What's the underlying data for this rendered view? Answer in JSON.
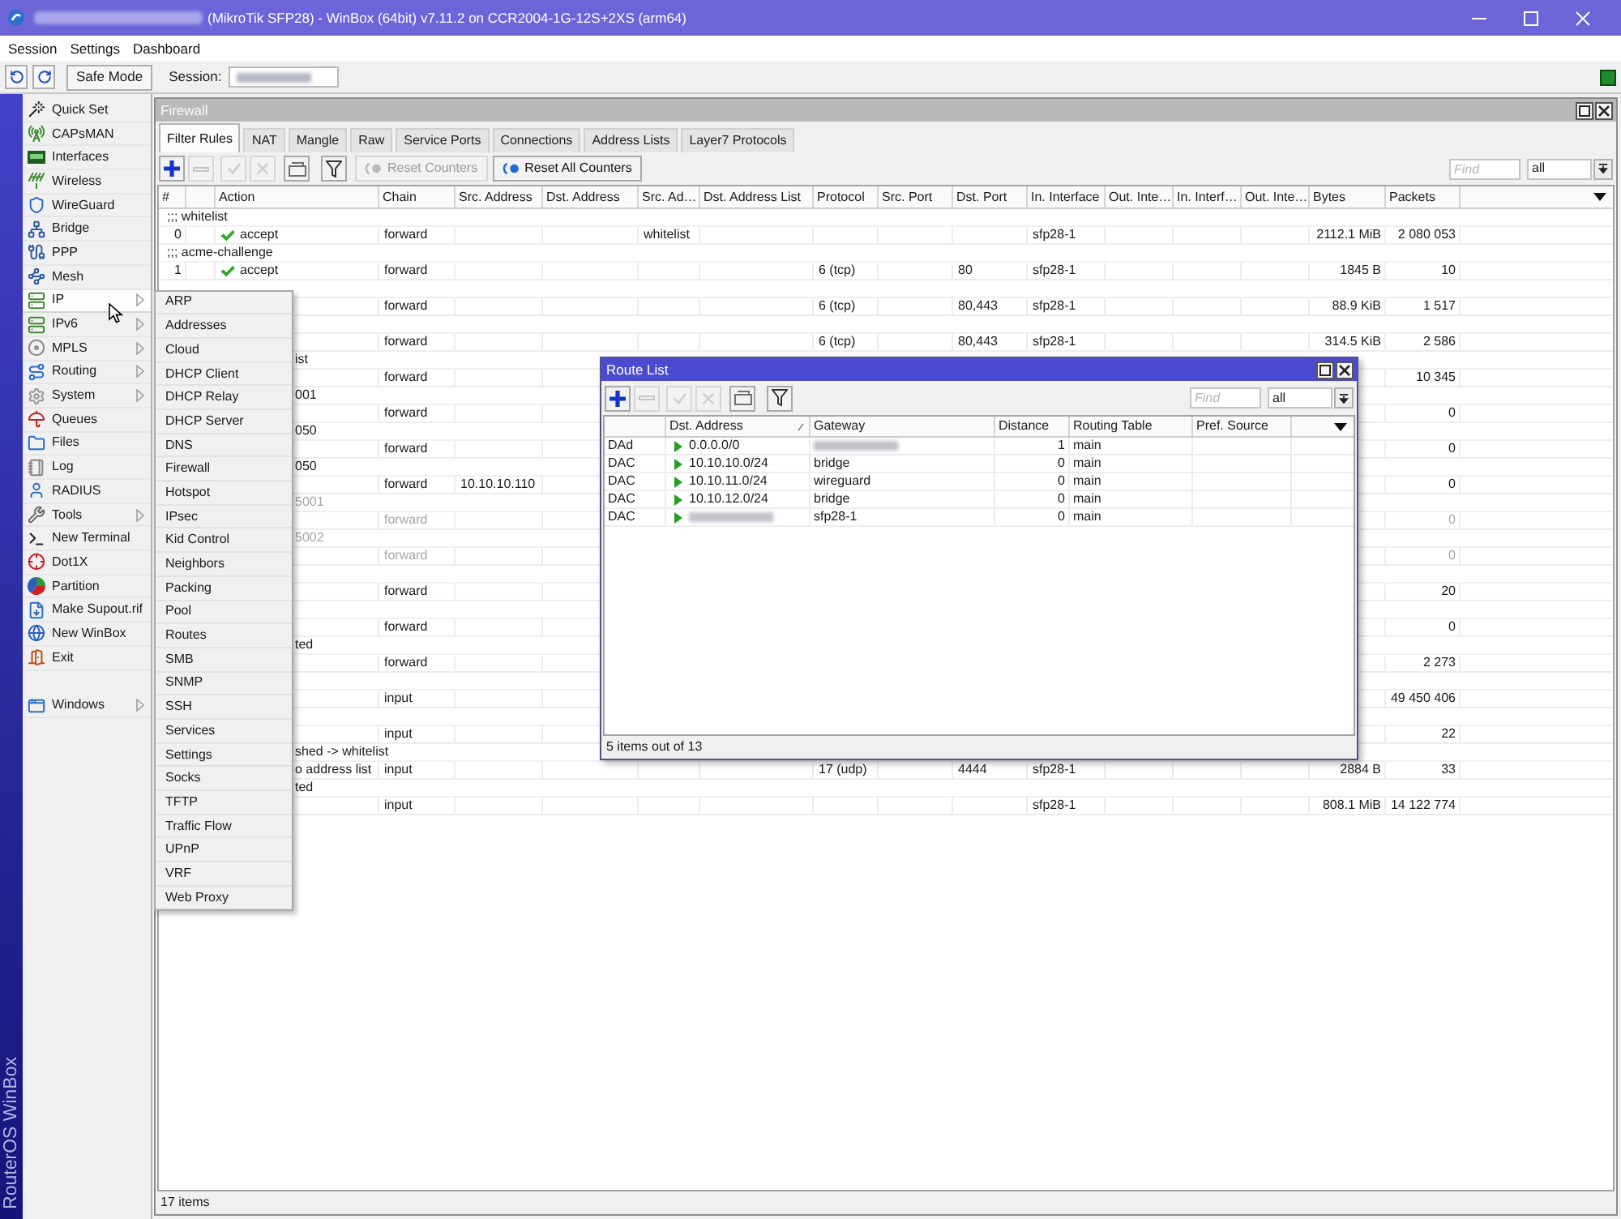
{
  "window": {
    "title_prefix_blurred": true,
    "title": "(MikroTik SFP28) - WinBox (64bit) v7.11.2 on CCR2004-1G-12S+2XS (arm64)"
  },
  "menu_bar": [
    "Session",
    "Settings",
    "Dashboard"
  ],
  "toolbar": {
    "safe_mode": "Safe Mode",
    "session": {
      "label": "Session:",
      "value_blurred": true
    }
  },
  "brand": "RouterOS WinBox",
  "sidebar": {
    "sections": [
      {
        "items": [
          {
            "label": "Quick Set",
            "kind": "command",
            "selected": false
          },
          {
            "label": "CAPsMAN",
            "kind": "command",
            "selected": false
          },
          {
            "label": "Interfaces",
            "kind": "command",
            "selected": false
          },
          {
            "label": "Wireless",
            "kind": "command",
            "selected": false
          },
          {
            "label": "WireGuard",
            "kind": "command",
            "selected": false
          },
          {
            "label": "Bridge",
            "kind": "command",
            "selected": false
          },
          {
            "label": "PPP",
            "kind": "command",
            "selected": false
          },
          {
            "label": "Mesh",
            "kind": "command",
            "selected": false
          },
          {
            "label": "IP",
            "kind": "submenu",
            "selected": true,
            "submenu": [
              "ARP",
              "Addresses",
              "Cloud",
              "DHCP Client",
              "DHCP Relay",
              "DHCP Server",
              "DNS",
              "Firewall",
              "Hotspot",
              "IPsec",
              "Kid Control",
              "Neighbors",
              "Packing",
              "Pool",
              "Routes",
              "SMB",
              "SNMP",
              "SSH",
              "Services",
              "Settings",
              "Socks",
              "TFTP",
              "Traffic Flow",
              "UPnP",
              "VRF",
              "Web Proxy"
            ]
          },
          {
            "label": "IPv6",
            "kind": "submenu",
            "selected": false
          },
          {
            "label": "MPLS",
            "kind": "submenu",
            "selected": false
          },
          {
            "label": "Routing",
            "kind": "submenu",
            "selected": false
          },
          {
            "label": "System",
            "kind": "submenu",
            "selected": false
          },
          {
            "label": "Queues",
            "kind": "command",
            "selected": false
          },
          {
            "label": "Files",
            "kind": "command",
            "selected": false
          },
          {
            "label": "Log",
            "kind": "command",
            "selected": false
          },
          {
            "label": "RADIUS",
            "kind": "command",
            "selected": false
          },
          {
            "label": "Tools",
            "kind": "submenu",
            "selected": false
          },
          {
            "label": "New Terminal",
            "kind": "command",
            "selected": false
          },
          {
            "label": "Dot1X",
            "kind": "command",
            "selected": false
          },
          {
            "label": "Partition",
            "kind": "command",
            "selected": false
          },
          {
            "label": "Make Supout.rif",
            "kind": "command",
            "selected": false
          },
          {
            "label": "New WinBox",
            "kind": "command",
            "selected": false
          },
          {
            "label": "Exit",
            "kind": "command",
            "selected": false
          }
        ]
      },
      {
        "items": [
          {
            "label": "Windows",
            "kind": "submenu",
            "selected": false
          }
        ]
      }
    ]
  },
  "firewall": {
    "title": "Firewall",
    "active": false,
    "tabs": [
      {
        "label": "Filter Rules",
        "selected": true
      },
      {
        "label": "NAT",
        "selected": false
      },
      {
        "label": "Mangle",
        "selected": false
      },
      {
        "label": "Raw",
        "selected": false
      },
      {
        "label": "Service Ports",
        "selected": false
      },
      {
        "label": "Connections",
        "selected": false
      },
      {
        "label": "Address Lists",
        "selected": false
      },
      {
        "label": "Layer7 Protocols",
        "selected": false
      }
    ],
    "tools": [
      {
        "kind": "add",
        "disabled": false
      },
      {
        "kind": "remove",
        "disabled": true
      },
      {
        "kind": "enable",
        "disabled": true
      },
      {
        "kind": "disable",
        "disabled": true
      },
      {
        "kind": "comment",
        "disabled": false
      },
      {
        "kind": "filter",
        "disabled": false
      }
    ],
    "counter_buttons": [
      {
        "label": "Reset Counters",
        "disabled": true
      },
      {
        "label": "Reset All Counters",
        "disabled": false
      }
    ],
    "find": {
      "placeholder": "Find"
    },
    "filter_value": "all",
    "columns": [
      "#",
      "Action",
      "Chain",
      "Src. Address",
      "Dst. Address",
      "Src. Ad…",
      "Dst. Address List",
      "Protocol",
      "Src. Port",
      "Dst. Port",
      "In. Interface",
      "Out. Inte…",
      "In. Interf…",
      "Out. Inte…",
      "Bytes",
      "Packets"
    ],
    "rules": [
      {
        "comment": ";;; whitelist",
        "number": "0",
        "action": "accept",
        "chain": "forward",
        "column_6": "whitelist",
        "in_interface": "sfp28-1",
        "bytes": "2112.1 MiB",
        "packets": "2 080 053",
        "disabled": false
      },
      {
        "comment": ";;; acme-challenge",
        "number": "1",
        "action": "accept",
        "chain": "forward",
        "protocol": "6 (tcp)",
        "dst_port": "80",
        "in_interface": "sfp28-1",
        "bytes": "1845 B",
        "packets": "10",
        "disabled": false
      },
      {
        "chain": "forward",
        "protocol": "6 (tcp)",
        "dst_port": "80,443",
        "in_interface": "sfp28-1",
        "bytes": "88.9 KiB",
        "packets": "1 517",
        "disabled": false
      },
      {
        "chain": "forward",
        "protocol": "6 (tcp)",
        "dst_port": "80,443",
        "in_interface": "sfp28-1",
        "bytes": "314.5 KiB",
        "packets": "2 586",
        "disabled": false
      },
      {
        "comment": "ist",
        "chain": "forward",
        "packets": "10 345",
        "disabled": false
      },
      {
        "comment": "001",
        "chain": "forward",
        "packets": "0",
        "disabled": false
      },
      {
        "comment": "050",
        "chain": "forward",
        "packets": "0",
        "disabled": false
      },
      {
        "comment": "050",
        "chain": "forward",
        "src_address": "10.10.10.110",
        "packets": "0",
        "disabled": false
      },
      {
        "comment": "5001",
        "chain": "forward",
        "packets": "0",
        "disabled": true
      },
      {
        "comment": "5002",
        "chain": "forward",
        "packets": "0",
        "disabled": true
      },
      {
        "chain": "forward",
        "packets": "20",
        "disabled": false
      },
      {
        "chain": "forward",
        "packets": "0",
        "disabled": false
      },
      {
        "comment": "ted",
        "chain": "forward",
        "packets": "2 273",
        "disabled": false
      },
      {
        "chain": "input",
        "packets": "49 450 406",
        "disabled": false
      },
      {
        "chain": "input",
        "packets": "22",
        "disabled": false
      },
      {
        "comment": "shed -> whitelist",
        "action": "o address list",
        "chain": "input",
        "protocol": "17 (udp)",
        "dst_port": "4444",
        "in_interface": "sfp28-1",
        "bytes": "2884 B",
        "packets": "33",
        "disabled": false
      },
      {
        "comment": "ted",
        "chain": "input",
        "in_interface": "sfp28-1",
        "bytes": "808.1 MiB",
        "packets": "14 122 774",
        "disabled": false
      }
    ],
    "status": "17 items"
  },
  "route_list": {
    "title": "Route List",
    "active": true,
    "tools": [
      {
        "kind": "add",
        "disabled": false
      },
      {
        "kind": "remove",
        "disabled": true
      },
      {
        "kind": "enable",
        "disabled": true
      },
      {
        "kind": "disable",
        "disabled": true
      },
      {
        "kind": "comment",
        "disabled": false
      },
      {
        "kind": "filter",
        "disabled": false
      }
    ],
    "find": {
      "placeholder": "Find"
    },
    "filter_value": "all",
    "columns": [
      {
        "label": "Dst. Address",
        "sorted": true
      },
      {
        "label": "Gateway",
        "sorted": false
      },
      {
        "label": "Distance",
        "sorted": false
      },
      {
        "label": "Routing Table",
        "sorted": false
      },
      {
        "label": "Pref. Source",
        "sorted": false
      }
    ],
    "routes": [
      {
        "flags": "DAd",
        "dst_address": "0.0.0.0/0",
        "gateway": {
          "blurred": true
        },
        "distance": "1",
        "routing_table": "main"
      },
      {
        "flags": "DAC",
        "dst_address": "10.10.10.0/24",
        "gateway": "bridge",
        "distance": "0",
        "routing_table": "main"
      },
      {
        "flags": "DAC",
        "dst_address": "10.10.11.0/24",
        "gateway": "wireguard",
        "distance": "0",
        "routing_table": "main"
      },
      {
        "flags": "DAC",
        "dst_address": "10.10.12.0/24",
        "gateway": "bridge",
        "distance": "0",
        "routing_table": "main"
      },
      {
        "flags": "DAC",
        "dst_address": {
          "blurred": true
        },
        "gateway": "sfp28-1",
        "distance": "0",
        "routing_table": "main"
      }
    ],
    "status": "5 items out of 13"
  }
}
